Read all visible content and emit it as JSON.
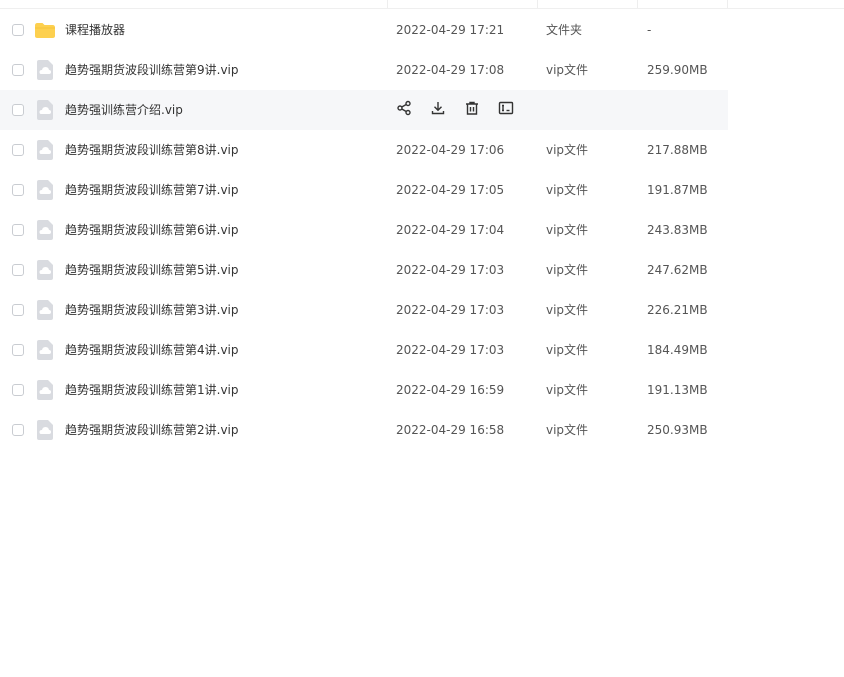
{
  "file_list": {
    "rows": [
      {
        "name": "课程播放器",
        "time": "2022-04-29 17:21",
        "type": "文件夹",
        "size": "-",
        "icon": "folder-icon"
      },
      {
        "name": "趋势强期货波段训练营第9讲.vip",
        "time": "2022-04-29 17:08",
        "type": "vip文件",
        "size": "259.90MB",
        "icon": "file-icon"
      },
      {
        "name": "趋势强训练营介绍.vip",
        "time": "",
        "type": "",
        "size": "",
        "icon": "file-icon",
        "hovered": true,
        "actions": [
          "share-icon",
          "download-icon",
          "delete-icon",
          "rename-icon"
        ]
      },
      {
        "name": "趋势强期货波段训练营第8讲.vip",
        "time": "2022-04-29 17:06",
        "type": "vip文件",
        "size": "217.88MB",
        "icon": "file-icon"
      },
      {
        "name": "趋势强期货波段训练营第7讲.vip",
        "time": "2022-04-29 17:05",
        "type": "vip文件",
        "size": "191.87MB",
        "icon": "file-icon"
      },
      {
        "name": "趋势强期货波段训练营第6讲.vip",
        "time": "2022-04-29 17:04",
        "type": "vip文件",
        "size": "243.83MB",
        "icon": "file-icon"
      },
      {
        "name": "趋势强期货波段训练营第5讲.vip",
        "time": "2022-04-29 17:03",
        "type": "vip文件",
        "size": "247.62MB",
        "icon": "file-icon"
      },
      {
        "name": "趋势强期货波段训练营第3讲.vip",
        "time": "2022-04-29 17:03",
        "type": "vip文件",
        "size": "226.21MB",
        "icon": "file-icon"
      },
      {
        "name": "趋势强期货波段训练营第4讲.vip",
        "time": "2022-04-29 17:03",
        "type": "vip文件",
        "size": "184.49MB",
        "icon": "file-icon"
      },
      {
        "name": "趋势强期货波段训练营第1讲.vip",
        "time": "2022-04-29 16:59",
        "type": "vip文件",
        "size": "191.13MB",
        "icon": "file-icon"
      },
      {
        "name": "趋势强期货波段训练营第2讲.vip",
        "time": "2022-04-29 16:58",
        "type": "vip文件",
        "size": "250.93MB",
        "icon": "file-icon"
      }
    ]
  },
  "colors": {
    "folder": "#fdd04f",
    "file_icon": "#d9dbe0",
    "hover_row": "#f6f7f9",
    "text": "#333333"
  }
}
